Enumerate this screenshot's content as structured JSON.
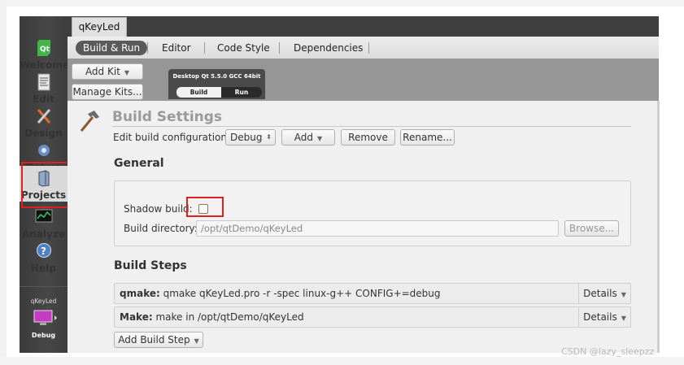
{
  "modes": [
    {
      "label": "Welcome",
      "icon": "qt-logo-icon"
    },
    {
      "label": "Edit",
      "icon": "document-icon"
    },
    {
      "label": "Design",
      "icon": "design-tools-icon"
    },
    {
      "label": "Debug",
      "icon": "debug-bug-icon"
    },
    {
      "label": "Projects",
      "icon": "projects-icon"
    },
    {
      "label": "Analyze",
      "icon": "analyze-monitor-icon"
    },
    {
      "label": "Help",
      "icon": "help-icon"
    }
  ],
  "target": {
    "project": "qKeyLed",
    "mode": "Debug"
  },
  "project_tab": "qKeyLed",
  "subtabs": [
    "Build & Run",
    "Editor",
    "Code Style",
    "Dependencies"
  ],
  "kit": {
    "add_kit": "Add Kit",
    "manage_kits": "Manage Kits...",
    "name": "Desktop Qt 5.5.0 GCC 64bit",
    "build": "Build",
    "run": "Run"
  },
  "build_settings": {
    "title": "Build Settings",
    "config_label": "Edit build configuration:",
    "config_value": "Debug",
    "add": "Add",
    "remove": "Remove",
    "rename": "Rename..."
  },
  "general": {
    "title": "General",
    "shadow_build_label": "Shadow build:",
    "shadow_build_checked": false,
    "build_dir_label": "Build directory:",
    "build_dir_value": "/opt/qtDemo/qKeyLed",
    "browse": "Browse..."
  },
  "build_steps": {
    "title": "Build Steps",
    "steps": [
      {
        "name": "qmake:",
        "command": "qmake qKeyLed.pro -r -spec linux-g++ CONFIG+=debug",
        "details": "Details"
      },
      {
        "name": "Make:",
        "command": "make in /opt/qtDemo/qKeyLed",
        "details": "Details"
      }
    ],
    "add_step": "Add Build Step"
  },
  "watermark": "CSDN @lazy_sleepzz",
  "colors": {
    "highlight": "#e02020",
    "modebar": "#3f3f3f",
    "kit_area": "#969696"
  }
}
